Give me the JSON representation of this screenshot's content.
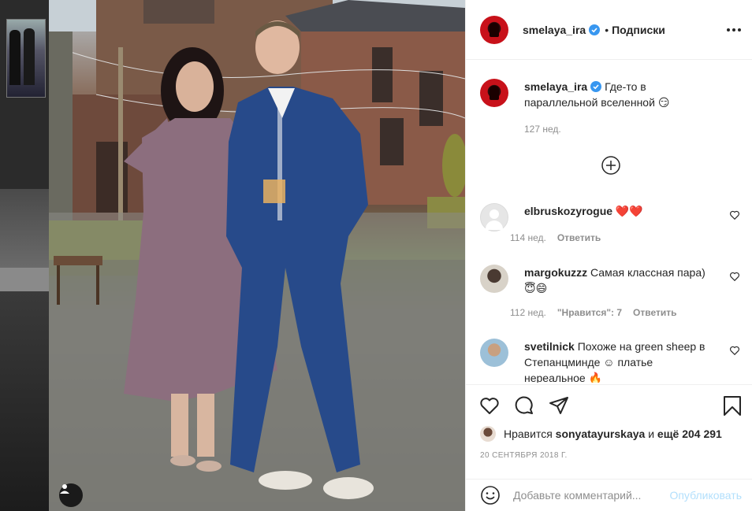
{
  "post": {
    "author": "smelaya_ira",
    "separator": "•",
    "follow_label": "Подписки",
    "caption_text": "Где-то в параллельной вселенной",
    "caption_emoji": "😏",
    "caption_time": "127 нед."
  },
  "comments": [
    {
      "user": "elbruskozyrogue",
      "text": "",
      "emoji": "❤️❤️",
      "time": "114 нед.",
      "likes": "",
      "reply": "Ответить"
    },
    {
      "user": "margokuzzz",
      "text": "Самая классная пара)",
      "emoji": "😇😄",
      "time": "112 нед.",
      "likes": "\"Нравится\": 7",
      "reply": "Ответить"
    },
    {
      "user": "svetilnick",
      "text": "Похоже на green sheep в Степанцминде ☺ платье нереальное",
      "emoji": "🔥",
      "time": "",
      "likes": "",
      "reply": ""
    }
  ],
  "likes_summary": {
    "prefix": "Нравится",
    "user": "sonyatayurskaya",
    "conjunction": "и",
    "others": "ещё 204 291"
  },
  "date": "20 СЕНТЯБРЯ 2018 Г.",
  "add_comment": {
    "placeholder": "Добавьте комментарий...",
    "post_label": "Опубликовать"
  },
  "icons": [
    "user-tag-icon",
    "verified-icon",
    "more-icon",
    "load-more-icon",
    "heart-icon",
    "comment-icon",
    "share-icon",
    "bookmark-icon",
    "emoji-icon"
  ],
  "colors": {
    "verified": "#3897f0",
    "post_button_disabled": "#b2dffc",
    "meta": "#8e8e8e",
    "like_heart": "#ed4956"
  }
}
